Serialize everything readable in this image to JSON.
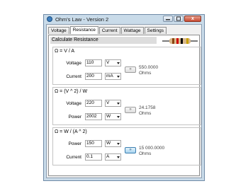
{
  "window": {
    "title": "Ohm's Law - Version 2",
    "close_glyph": "x"
  },
  "tabs": [
    {
      "label": "Voltage"
    },
    {
      "label": "Resistance"
    },
    {
      "label": "Current"
    },
    {
      "label": "Wattage"
    },
    {
      "label": "Settings"
    }
  ],
  "active_tab": "Resistance",
  "section_header": "Calculate Resistance",
  "resistor_bands": [
    "#8b4513",
    "#d00000",
    "#000000",
    "#c8a000"
  ],
  "groups": [
    {
      "formula": "Ω = V / A",
      "row1": {
        "label": "Voltage",
        "value": "110",
        "unit": "V"
      },
      "row2": {
        "label": "Current",
        "value": "200",
        "unit": "mA"
      },
      "calc": "»",
      "result": {
        "value": "550.0000",
        "unit": "Ohms"
      }
    },
    {
      "formula": "Ω = (V ^ 2) / W",
      "row1": {
        "label": "Voltage",
        "value": "220",
        "unit": "V"
      },
      "row2": {
        "label": "Power",
        "value": "2002",
        "unit": "W"
      },
      "calc": "»",
      "result": {
        "value": "24.1758",
        "unit": "Ohms"
      }
    },
    {
      "formula": "Ω = W / (A ^ 2)",
      "row1": {
        "label": "Power",
        "value": "150",
        "unit": "W"
      },
      "row2": {
        "label": "Current",
        "value": "0.1",
        "unit": "A"
      },
      "calc": "»",
      "result": {
        "value": "15 000.0000",
        "unit": "Ohms"
      }
    }
  ]
}
